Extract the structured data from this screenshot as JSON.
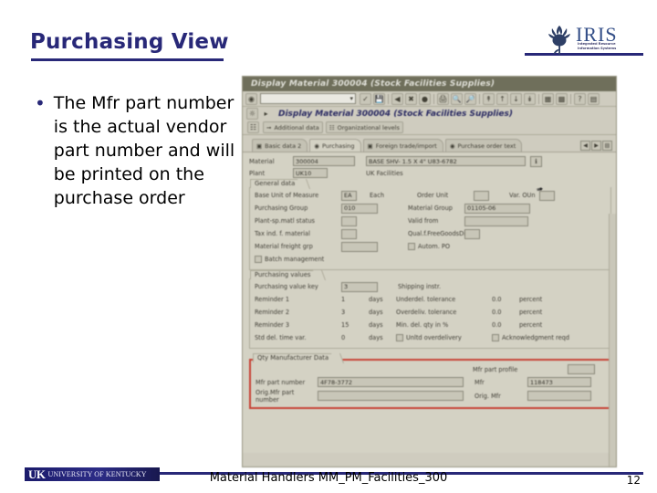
{
  "slide": {
    "title": "Purchasing View",
    "bullet": "The  Mfr part number is the actual vendor part number and will be printed on the purchase order",
    "bullet_marker": "•"
  },
  "logo": {
    "iris_word": "IRIS",
    "iris_subtitle": "Integrated Resource Information Systems"
  },
  "footer": {
    "uk_mark": "UK",
    "uk_name": "UNIVERSITY OF KENTUCKY",
    "course": "Material Handlers MM_PM_Facilities_300",
    "page_number": "12"
  },
  "sap": {
    "window_title": "Display Material 300004 (Stock Facilities Supplies)",
    "screen_title": "Display Material 300004 (Stock Facilities Supplies)",
    "command_field_value": "",
    "toolbar_icons": [
      "sap-logo-icon",
      "enter-icon",
      "save-icon",
      "back-icon",
      "exit-icon",
      "cancel-icon",
      "print-icon",
      "find-icon",
      "find-next-icon",
      "first-page-icon",
      "previous-page-icon",
      "next-page-icon",
      "last-page-icon",
      "new-session-icon",
      "create-shortcut-icon",
      "help-icon",
      "layout-menu-icon"
    ],
    "app_buttons": [
      {
        "label": "",
        "icon": "additional-data-icon"
      },
      {
        "label": "Additional data",
        "icon": "arrow-right-icon"
      },
      {
        "label": "Organizational levels",
        "icon": "org-levels-icon"
      }
    ],
    "tabs": [
      {
        "label": "Basic data 2",
        "icon": "tab-icon",
        "active": false
      },
      {
        "label": "Purchasing",
        "icon": "tab-icon",
        "active": true
      },
      {
        "label": "Foreign trade/import",
        "icon": "tab-icon",
        "active": false
      },
      {
        "label": "Purchase order text",
        "icon": "tab-icon",
        "active": false
      }
    ],
    "tab_nav": [
      "◀",
      "▶",
      "▤"
    ],
    "header": {
      "material_label": "Material",
      "material_value": "300004",
      "material_desc": "BASE SHV- 1.5 X 4\" U83-6782",
      "plant_label": "Plant",
      "plant_value": "UK10",
      "plant_desc": "UK Facilities",
      "help_icon": "info-icon"
    },
    "general_data": {
      "section_label": "General data",
      "rows": [
        {
          "label": "Base Unit of Measure",
          "value": "EA",
          "extra": "Each",
          "label2": "Order Unit",
          "value2": "",
          "label3": "Var. OUn",
          "value3": ""
        },
        {
          "label": "Purchasing Group",
          "value": "010",
          "extra": "",
          "label2": "Material Group",
          "value2": "01105-06",
          "label3": "",
          "value3": ""
        },
        {
          "label": "Plant-sp.matl status",
          "value": "",
          "extra": "",
          "label2": "Valid from",
          "value2": "",
          "label3": "",
          "value3": ""
        },
        {
          "label": "Tax ind. f. material",
          "value": "",
          "extra": "",
          "label2": "Qual.f.FreeGoodsDis.",
          "value2": "",
          "label3": "",
          "value3": ""
        },
        {
          "label": "Material freight grp",
          "value": "",
          "extra": "",
          "label2": "Autom. PO",
          "value2": "",
          "label3": "",
          "value3": ""
        }
      ],
      "batch_management": "Batch management"
    },
    "purchasing_values": {
      "section_label": "Purchasing values",
      "rows": [
        {
          "label": "Purchasing value key",
          "value": "3",
          "unit": "",
          "label2": "Shipping instr.",
          "value2": "",
          "unit2": ""
        },
        {
          "label": "Reminder 1",
          "value": "1",
          "unit": "days",
          "label2": "Underdel. tolerance",
          "value2": "0.0",
          "unit2": "percent"
        },
        {
          "label": "Reminder 2",
          "value": "3",
          "unit": "days",
          "label2": "Overdeliv. tolerance",
          "value2": "0.0",
          "unit2": "percent"
        },
        {
          "label": "Reminder 3",
          "value": "15",
          "unit": "days",
          "label2": "Min. del. qty in %",
          "value2": "0.0",
          "unit2": "percent"
        },
        {
          "label": "Std del. time var.",
          "value": "0",
          "unit": "days",
          "label2": "Unltd overdelivery",
          "value2": "",
          "unit2": "Acknowledgment reqd"
        }
      ]
    },
    "manufacturer_data": {
      "section_label": "Qty Manufacturer Data",
      "mfr_part_profile_label": "Mfr part profile",
      "mfr_part_profile_value": "",
      "mfr_part_number_label": "Mfr part number",
      "mfr_part_number_value": "4F78-3772",
      "mfr_label": "Mfr",
      "mfr_value": "118473",
      "orig_part_number_label": "Orig.Mfr part number",
      "orig_part_number_value": "",
      "orig_mfr_label": "Orig. Mfr",
      "orig_mfr_value": "",
      "highlight_color": "#e03a2a"
    }
  }
}
